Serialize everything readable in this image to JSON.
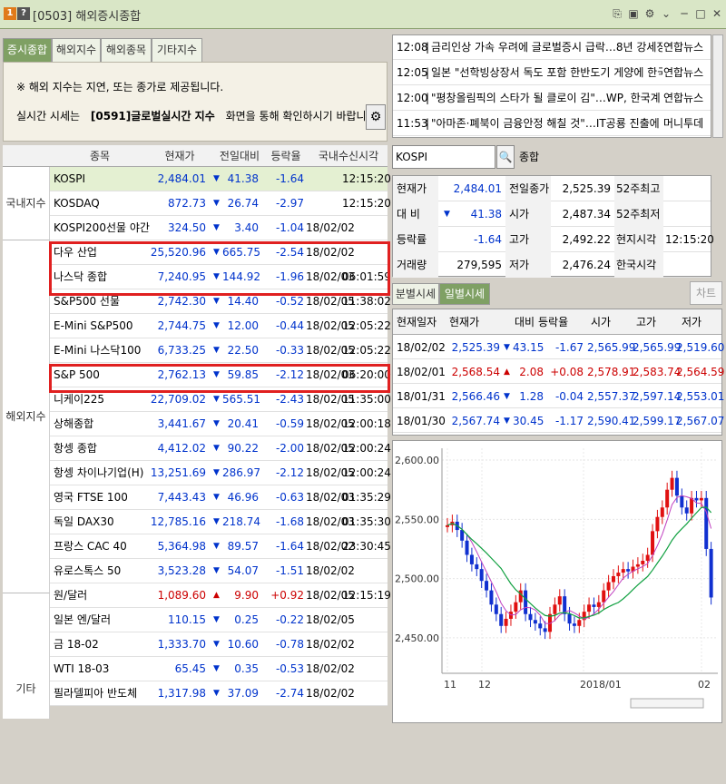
{
  "window": {
    "badge1": "1",
    "badge2": "?",
    "title": "[0503] 해외증시종합",
    "controls": [
      "⎘",
      "▣",
      "⚙",
      "⌄",
      "─",
      "□",
      "✕"
    ]
  },
  "tabs": [
    "증시종합",
    "해외지수",
    "해외종목",
    "기타지수"
  ],
  "notice": {
    "line1": "※ 해외 지수는 지연, 또는 종가로 제공됩니다.",
    "line2a": "실시간 시세는",
    "line2b": "[0591]글로벌실시간 지수",
    "line2c": "화면을 통해 확인하시기 바랍니다."
  },
  "grid": {
    "headers": [
      "종목",
      "현재가",
      "전일대비",
      "등락율",
      "국내수신시각"
    ],
    "categories": [
      "국내지수",
      "해외지수",
      "기타"
    ],
    "rows": [
      {
        "name": "KOSPI",
        "price": "2,484.01",
        "dir": "down",
        "chg": "41.38",
        "pct": "-1.64",
        "date": "",
        "time": "12:15:20",
        "hl": true
      },
      {
        "name": "KOSDAQ",
        "price": "872.73",
        "dir": "down",
        "chg": "26.74",
        "pct": "-2.97",
        "date": "",
        "time": "12:15:20",
        "hl": false
      },
      {
        "name": "KOSPI200선물 야간",
        "price": "324.50",
        "dir": "down",
        "chg": "3.40",
        "pct": "-1.04",
        "date": "18/02/02",
        "time": "",
        "hl": false
      },
      {
        "name": "다우 산업",
        "price": "25,520.96",
        "dir": "down",
        "chg": "665.75",
        "pct": "-2.54",
        "date": "18/02/02",
        "time": "",
        "hl": false
      },
      {
        "name": "나스닥 종합",
        "price": "7,240.95",
        "dir": "down",
        "chg": "144.92",
        "pct": "-1.96",
        "date": "18/02/03",
        "time": "06:01:59",
        "hl": false
      },
      {
        "name": "S&P500 선물",
        "price": "2,742.30",
        "dir": "down",
        "chg": "14.40",
        "pct": "-0.52",
        "date": "18/02/05",
        "time": "11:38:02",
        "hl": false
      },
      {
        "name": "E-Mini S&P500",
        "price": "2,744.75",
        "dir": "down",
        "chg": "12.00",
        "pct": "-0.44",
        "date": "18/02/05",
        "time": "12:05:22",
        "hl": false
      },
      {
        "name": "E-Mini 나스닥100",
        "price": "6,733.25",
        "dir": "down",
        "chg": "22.50",
        "pct": "-0.33",
        "date": "18/02/05",
        "time": "12:05:22",
        "hl": false
      },
      {
        "name": "S&P 500",
        "price": "2,762.13",
        "dir": "down",
        "chg": "59.85",
        "pct": "-2.12",
        "date": "18/02/03",
        "time": "06:20:00",
        "hl": false
      },
      {
        "name": "니케이225",
        "price": "22,709.02",
        "dir": "down",
        "chg": "565.51",
        "pct": "-2.43",
        "date": "18/02/05",
        "time": "11:35:00",
        "hl": false
      },
      {
        "name": "상해종합",
        "price": "3,441.67",
        "dir": "down",
        "chg": "20.41",
        "pct": "-0.59",
        "date": "18/02/05",
        "time": "12:00:18",
        "hl": false
      },
      {
        "name": "항셍 종합",
        "price": "4,412.02",
        "dir": "down",
        "chg": "90.22",
        "pct": "-2.00",
        "date": "18/02/05",
        "time": "12:00:24",
        "hl": false
      },
      {
        "name": "항셍 차이나기업(H)",
        "price": "13,251.69",
        "dir": "down",
        "chg": "286.97",
        "pct": "-2.12",
        "date": "18/02/05",
        "time": "12:00:24",
        "hl": false
      },
      {
        "name": "영국 FTSE 100",
        "price": "7,443.43",
        "dir": "down",
        "chg": "46.96",
        "pct": "-0.63",
        "date": "18/02/03",
        "time": "01:35:29",
        "hl": false
      },
      {
        "name": "독일 DAX30",
        "price": "12,785.16",
        "dir": "down",
        "chg": "218.74",
        "pct": "-1.68",
        "date": "18/02/03",
        "time": "01:35:30",
        "hl": false
      },
      {
        "name": "프랑스 CAC 40",
        "price": "5,364.98",
        "dir": "down",
        "chg": "89.57",
        "pct": "-1.64",
        "date": "18/02/02",
        "time": "23:30:45",
        "hl": false
      },
      {
        "name": "유로스톡스 50",
        "price": "3,523.28",
        "dir": "down",
        "chg": "54.07",
        "pct": "-1.51",
        "date": "18/02/02",
        "time": "",
        "hl": false
      },
      {
        "name": "원/달러",
        "price": "1,089.60",
        "dir": "up",
        "chg": "9.90",
        "pct": "+0.92",
        "date": "18/02/05",
        "time": "12:15:19",
        "hl": false
      },
      {
        "name": "일본 엔/달러",
        "price": "110.15",
        "dir": "down",
        "chg": "0.25",
        "pct": "-0.22",
        "date": "18/02/05",
        "time": "",
        "hl": false
      },
      {
        "name": "금 18-02",
        "price": "1,333.70",
        "dir": "down",
        "chg": "10.60",
        "pct": "-0.78",
        "date": "18/02/02",
        "time": "",
        "hl": false
      },
      {
        "name": "WTI 18-03",
        "price": "65.45",
        "dir": "down",
        "chg": "0.35",
        "pct": "-0.53",
        "date": "18/02/02",
        "time": "",
        "hl": false
      },
      {
        "name": "필라델피아 반도체",
        "price": "1,317.98",
        "dir": "down",
        "chg": "37.09",
        "pct": "-2.74",
        "date": "18/02/02",
        "time": "",
        "hl": false
      }
    ]
  },
  "news": [
    {
      "time": "12:08",
      "headline": "금리인상 가속 우려에 글로벌증시 급락…8년 강세장 마",
      "source": "연합뉴스"
    },
    {
      "time": "12:05",
      "headline": "일본 \"선학빙상장서 독도 포함 한반도기 게양에 한국에",
      "source": "연합뉴스"
    },
    {
      "time": "12:00",
      "headline": "\"평창올림픽의 스타가 될 클로이 김\"…WP, 한국계 스노",
      "source": "연합뉴스"
    },
    {
      "time": "11:53",
      "headline": "\"아마존·폐북이 금융안정 해칠 것\"…IT공룡 진출에 금융",
      "source": "머니투데"
    }
  ],
  "search": {
    "code": "KOSPI",
    "name": "종합",
    "icon": "🔍"
  },
  "quote": [
    {
      "l1": "현재가",
      "v1": "2,484.01",
      "l2": "전일종가",
      "v2": "2,525.39",
      "l3": "52주최고",
      "v3": ""
    },
    {
      "l1": "대 비",
      "v1": "41.38",
      "l2": "시가",
      "v2": "2,487.34",
      "l3": "52주최저",
      "v3": ""
    },
    {
      "l1": "등락률",
      "v1": "-1.64",
      "l2": "고가",
      "v2": "2,492.22",
      "l3": "현지시각",
      "v3": "12:15:20"
    },
    {
      "l1": "거래량",
      "v1": "279,595",
      "l2": "저가",
      "v2": "2,476.24",
      "l3": "한국시각",
      "v3": ""
    }
  ],
  "subtabs": [
    "분별시세",
    "일별시세"
  ],
  "chart_button": "차트",
  "history": {
    "headers": [
      "현재일자",
      "현재가",
      "대비",
      "등락율",
      "시가",
      "고가",
      "저가"
    ],
    "rows": [
      {
        "date": "18/02/02",
        "price": "2,525.39",
        "dir": "down",
        "chg": "43.15",
        "pct": "-1.67",
        "open": "2,565.99",
        "high": "2,565.99",
        "low": "2,519.60",
        "color": "blue"
      },
      {
        "date": "18/02/01",
        "price": "2,568.54",
        "dir": "up",
        "chg": "2.08",
        "pct": "+0.08",
        "open": "2,578.91",
        "high": "2,583.74",
        "low": "2,564.59",
        "color": "red"
      },
      {
        "date": "18/01/31",
        "price": "2,566.46",
        "dir": "down",
        "chg": "1.28",
        "pct": "-0.04",
        "open": "2,557.37",
        "high": "2,597.14",
        "low": "2,553.01",
        "color": "blue"
      },
      {
        "date": "18/01/30",
        "price": "2,567.74",
        "dir": "down",
        "chg": "30.45",
        "pct": "-1.17",
        "open": "2,590.41",
        "high": "2,599.17",
        "low": "2,567.07",
        "color": "blue"
      }
    ]
  },
  "chart_data": {
    "type": "line",
    "y_ticks": [
      "2,600.00",
      "2,550.00",
      "2,500.00",
      "2,450.00"
    ],
    "ylim": [
      2420,
      2610
    ],
    "x_ticks": [
      "11",
      "12",
      "2018/01",
      "02"
    ],
    "series": [
      {
        "values": [
          2545,
          2548,
          2541,
          2532,
          2520,
          2512,
          2508,
          2498,
          2490,
          2478,
          2470,
          2460,
          2466,
          2472,
          2480,
          2490,
          2470,
          2465,
          2462,
          2458,
          2455,
          2470,
          2478,
          2485,
          2470,
          2462,
          2460,
          2465,
          2472,
          2478,
          2476,
          2480,
          2490,
          2497,
          2502,
          2505,
          2508,
          2506,
          2510,
          2512,
          2515,
          2520,
          2540,
          2552,
          2560,
          2575,
          2585,
          2570,
          2560,
          2555,
          2568,
          2566,
          2568,
          2525,
          2484
        ]
      }
    ]
  }
}
